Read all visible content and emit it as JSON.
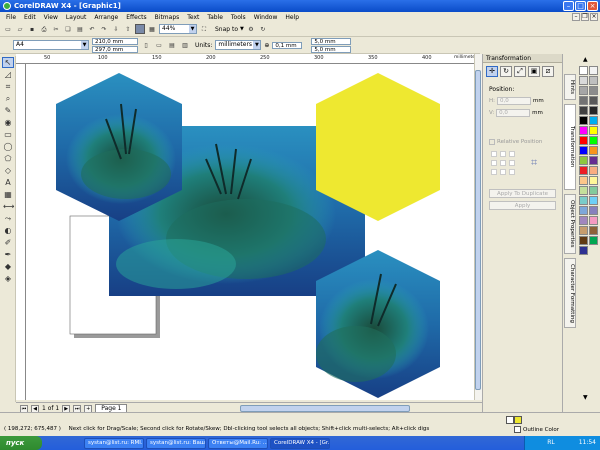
{
  "window": {
    "title": "CorelDRAW X4 - [Graphic1]"
  },
  "menu": {
    "items": [
      "File",
      "Edit",
      "View",
      "Layout",
      "Arrange",
      "Effects",
      "Bitmaps",
      "Text",
      "Table",
      "Tools",
      "Window",
      "Help"
    ]
  },
  "toolbar": {
    "zoom": "44%",
    "snap_to": "Snap to"
  },
  "propbar": {
    "page_size": "A4",
    "width": "210,0 mm",
    "height": "297,0 mm",
    "units_label": "Units:",
    "units": "millimeters",
    "nudge": "0,1 mm",
    "dup_x": "5,0 mm",
    "dup_y": "5,0 mm"
  },
  "ruler": {
    "unit": "millimeters",
    "h_ticks": [
      "50",
      "100",
      "150",
      "200",
      "250",
      "300",
      "350",
      "400"
    ]
  },
  "pagebar": {
    "page_count": "1 of 1",
    "page_tab": "Page 1"
  },
  "docker": {
    "title": "Transformation",
    "position_label": "Position:",
    "h_value": "0,0",
    "v_value": "0,0",
    "unit": "mm",
    "relative_label": "Relative Position",
    "apply_dup": "Apply To Duplicate",
    "apply": "Apply"
  },
  "side_tabs": [
    "Hints",
    "Transformation",
    "Object Properties",
    "Character Formatting"
  ],
  "status": {
    "coords": "( 198,272; 675,487 )",
    "hint": "Next click for Drag/Scale; Second click for Rotate/Skew; Dbl-clicking tool selects all objects; Shift+click multi-selects; Alt+click digs",
    "outline": "Outline Color"
  },
  "taskbar": {
    "start": "пуск",
    "tasks": [
      "systan@list.ru: RMI...",
      "systan@list.ru: Ваш...",
      "Ответы@Mail.Ru: ...",
      "CorelDRAW X4 - [Gr..."
    ],
    "lang": "RL",
    "time": "11:54"
  },
  "colors": {
    "title_blue": "#0a4cc8",
    "hexagon_yellow": "#eee830",
    "palette": [
      "#ffffff",
      "#f2f2f2",
      "#d9d9d9",
      "#bfbfbf",
      "#a6a6a6",
      "#8c8c8c",
      "#737373",
      "#595959",
      "#404040",
      "#262626",
      "#000000",
      "#00aeef",
      "#ff00ff",
      "#ffff00",
      "#ff0000",
      "#00ff00",
      "#0000ff",
      "#f7941d",
      "#8dc63f",
      "#662d91",
      "#ed1c24",
      "#f9ad81",
      "#fdc68a",
      "#fff799",
      "#c4df9b",
      "#82ca9c",
      "#7accc8",
      "#6dcff6",
      "#7da7d9",
      "#8781bd",
      "#a187be",
      "#f49ac2",
      "#c69c6d",
      "#8c6239",
      "#603913",
      "#00a651",
      "#2e3192"
    ]
  }
}
